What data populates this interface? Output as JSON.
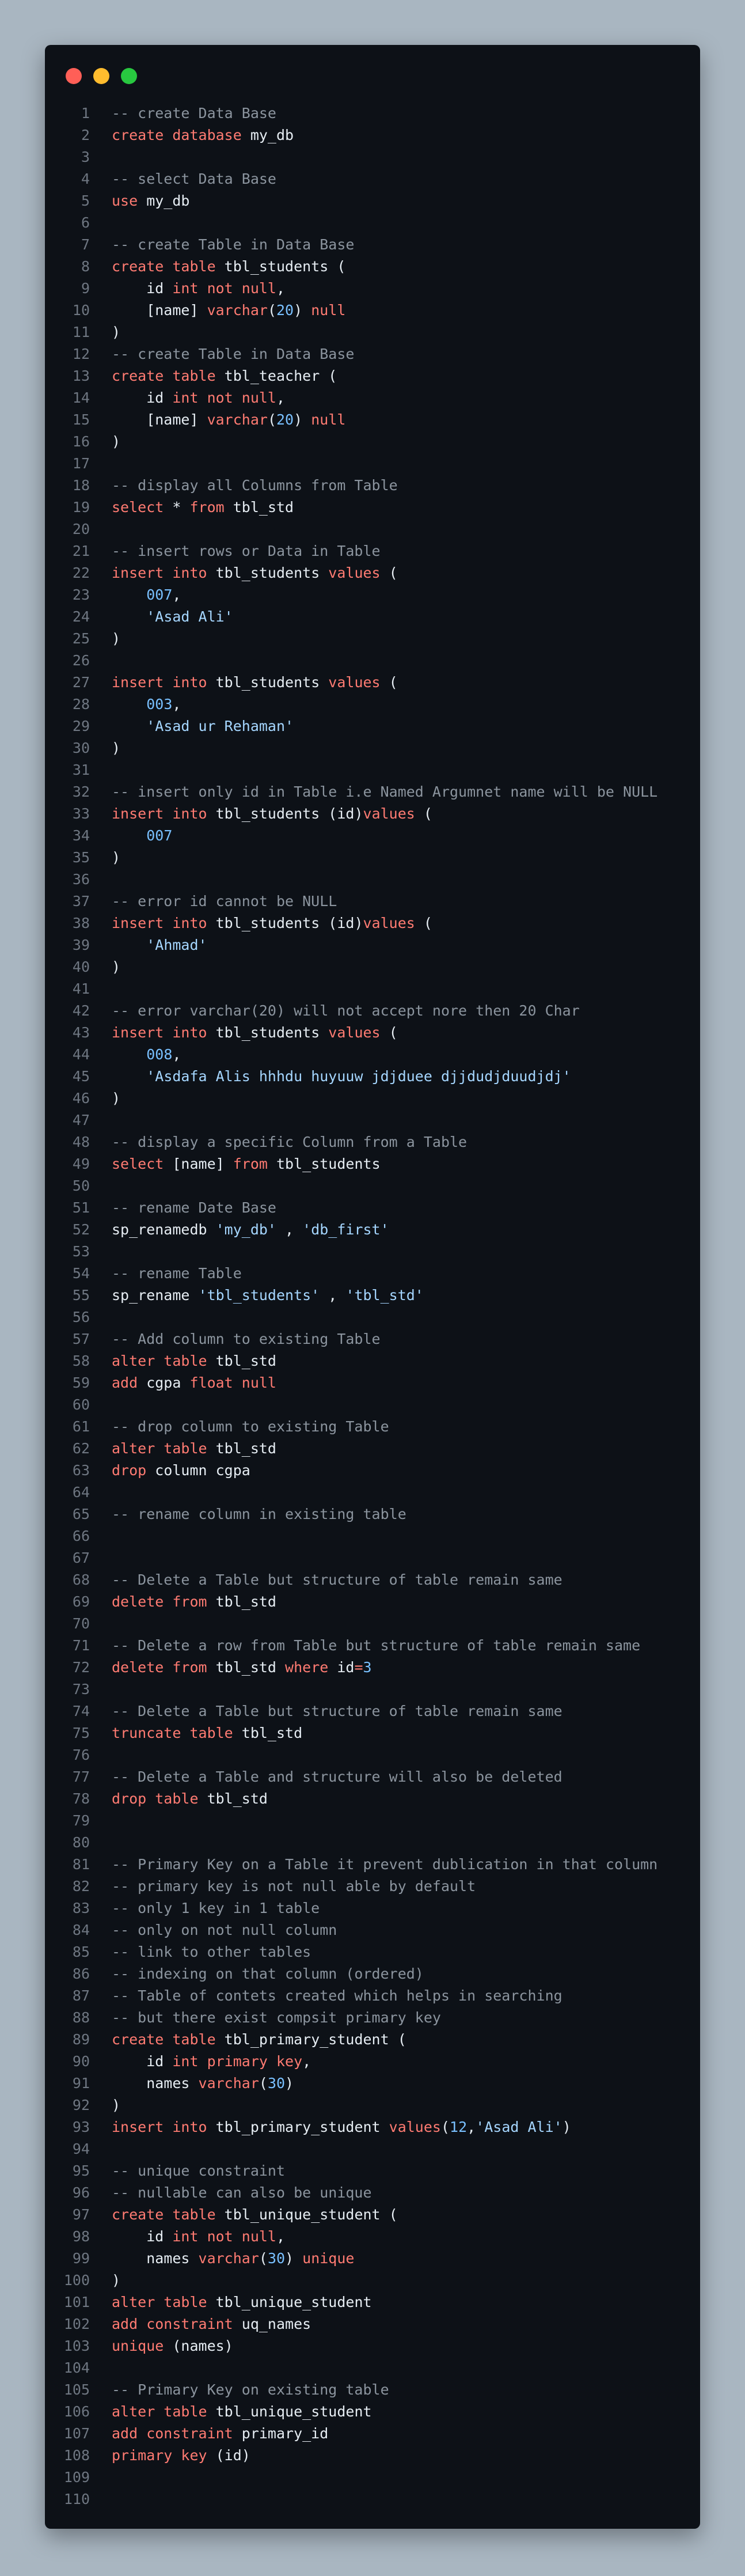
{
  "window": {
    "controls": {
      "close_color": "#ff5f57",
      "minimize_color": "#febc2e",
      "maximize_color": "#28c840"
    }
  },
  "theme": {
    "keyword": "#ff7b72",
    "comment": "#8b949e",
    "string": "#a5d6ff",
    "number": "#79c0ff",
    "text": "#e6edf3",
    "line_number": "#6e7681",
    "background": "#0d1117"
  },
  "editor": {
    "lines": [
      [
        [
          "c",
          "-- create Data Base"
        ]
      ],
      [
        [
          "k",
          "create database"
        ],
        [
          "p",
          " my_db"
        ]
      ],
      [],
      [
        [
          "c",
          "-- select Data Base"
        ]
      ],
      [
        [
          "k",
          "use"
        ],
        [
          "p",
          " my_db"
        ]
      ],
      [],
      [
        [
          "c",
          "-- create Table in Data Base"
        ]
      ],
      [
        [
          "k",
          "create table"
        ],
        [
          "p",
          " tbl_students ("
        ]
      ],
      [
        [
          "p",
          "    id "
        ],
        [
          "k",
          "int not null"
        ],
        [
          "p",
          ","
        ]
      ],
      [
        [
          "p",
          "    [name] "
        ],
        [
          "k",
          "varchar"
        ],
        [
          "p",
          "("
        ],
        [
          "n",
          "20"
        ],
        [
          "p",
          ") "
        ],
        [
          "k",
          "null"
        ]
      ],
      [
        [
          "p",
          ")"
        ]
      ],
      [
        [
          "c",
          "-- create Table in Data Base"
        ]
      ],
      [
        [
          "k",
          "create table"
        ],
        [
          "p",
          " tbl_teacher ("
        ]
      ],
      [
        [
          "p",
          "    id "
        ],
        [
          "k",
          "int not null"
        ],
        [
          "p",
          ","
        ]
      ],
      [
        [
          "p",
          "    [name] "
        ],
        [
          "k",
          "varchar"
        ],
        [
          "p",
          "("
        ],
        [
          "n",
          "20"
        ],
        [
          "p",
          ") "
        ],
        [
          "k",
          "null"
        ]
      ],
      [
        [
          "p",
          ")"
        ]
      ],
      [],
      [
        [
          "c",
          "-- display all Columns from Table"
        ]
      ],
      [
        [
          "k",
          "select"
        ],
        [
          "p",
          " * "
        ],
        [
          "k",
          "from"
        ],
        [
          "p",
          " tbl_std"
        ]
      ],
      [],
      [
        [
          "c",
          "-- insert rows or Data in Table"
        ]
      ],
      [
        [
          "k",
          "insert into"
        ],
        [
          "p",
          " tbl_students "
        ],
        [
          "k",
          "values"
        ],
        [
          "p",
          " ("
        ]
      ],
      [
        [
          "p",
          "    "
        ],
        [
          "n",
          "007"
        ],
        [
          "p",
          ","
        ]
      ],
      [
        [
          "p",
          "    "
        ],
        [
          "s",
          "'Asad Ali'"
        ]
      ],
      [
        [
          "p",
          ")"
        ]
      ],
      [],
      [
        [
          "k",
          "insert into"
        ],
        [
          "p",
          " tbl_students "
        ],
        [
          "k",
          "values"
        ],
        [
          "p",
          " ("
        ]
      ],
      [
        [
          "p",
          "    "
        ],
        [
          "n",
          "003"
        ],
        [
          "p",
          ","
        ]
      ],
      [
        [
          "p",
          "    "
        ],
        [
          "s",
          "'Asad ur Rehaman'"
        ]
      ],
      [
        [
          "p",
          ")"
        ]
      ],
      [],
      [
        [
          "c",
          "-- insert only id in Table i.e Named Argumnet name will be NULL"
        ]
      ],
      [
        [
          "k",
          "insert into"
        ],
        [
          "p",
          " tbl_students (id)"
        ],
        [
          "k",
          "values"
        ],
        [
          "p",
          " ("
        ]
      ],
      [
        [
          "p",
          "    "
        ],
        [
          "n",
          "007"
        ]
      ],
      [
        [
          "p",
          ")"
        ]
      ],
      [],
      [
        [
          "c",
          "-- error id cannot be NULL"
        ]
      ],
      [
        [
          "k",
          "insert into"
        ],
        [
          "p",
          " tbl_students (id)"
        ],
        [
          "k",
          "values"
        ],
        [
          "p",
          " ("
        ]
      ],
      [
        [
          "p",
          "    "
        ],
        [
          "s",
          "'Ahmad'"
        ]
      ],
      [
        [
          "p",
          ")"
        ]
      ],
      [],
      [
        [
          "c",
          "-- error varchar(20) will not accept nore then 20 Char"
        ]
      ],
      [
        [
          "k",
          "insert into"
        ],
        [
          "p",
          " tbl_students "
        ],
        [
          "k",
          "values"
        ],
        [
          "p",
          " ("
        ]
      ],
      [
        [
          "p",
          "    "
        ],
        [
          "n",
          "008"
        ],
        [
          "p",
          ","
        ]
      ],
      [
        [
          "p",
          "    "
        ],
        [
          "s",
          "'Asdafa Alis hhhdu huyuuw jdjduee djjdudjduudjdj'"
        ]
      ],
      [
        [
          "p",
          ")"
        ]
      ],
      [],
      [
        [
          "c",
          "-- display a specific Column from a Table"
        ]
      ],
      [
        [
          "k",
          "select"
        ],
        [
          "p",
          " [name] "
        ],
        [
          "k",
          "from"
        ],
        [
          "p",
          " tbl_students"
        ]
      ],
      [],
      [
        [
          "c",
          "-- rename Date Base"
        ]
      ],
      [
        [
          "p",
          "sp_renamedb "
        ],
        [
          "s",
          "'my_db'"
        ],
        [
          "p",
          " , "
        ],
        [
          "s",
          "'db_first'"
        ]
      ],
      [],
      [
        [
          "c",
          "-- rename Table"
        ]
      ],
      [
        [
          "p",
          "sp_rename "
        ],
        [
          "s",
          "'tbl_students'"
        ],
        [
          "p",
          " , "
        ],
        [
          "s",
          "'tbl_std'"
        ]
      ],
      [],
      [
        [
          "c",
          "-- Add column to existing Table"
        ]
      ],
      [
        [
          "k",
          "alter table"
        ],
        [
          "p",
          " tbl_std"
        ]
      ],
      [
        [
          "k",
          "add"
        ],
        [
          "p",
          " cgpa "
        ],
        [
          "k",
          "float null"
        ]
      ],
      [],
      [
        [
          "c",
          "-- drop column to existing Table"
        ]
      ],
      [
        [
          "k",
          "alter table"
        ],
        [
          "p",
          " tbl_std"
        ]
      ],
      [
        [
          "k",
          "drop"
        ],
        [
          "p",
          " column cgpa"
        ]
      ],
      [],
      [
        [
          "c",
          "-- rename column in existing table"
        ]
      ],
      [],
      [],
      [
        [
          "c",
          "-- Delete a Table but structure of table remain same"
        ]
      ],
      [
        [
          "k",
          "delete from"
        ],
        [
          "p",
          " tbl_std"
        ]
      ],
      [],
      [
        [
          "c",
          "-- Delete a row from Table but structure of table remain same"
        ]
      ],
      [
        [
          "k",
          "delete from"
        ],
        [
          "p",
          " tbl_std "
        ],
        [
          "k",
          "where"
        ],
        [
          "p",
          " id"
        ],
        [
          "k",
          "="
        ],
        [
          "n",
          "3"
        ]
      ],
      [],
      [
        [
          "c",
          "-- Delete a Table but structure of table remain same"
        ]
      ],
      [
        [
          "k",
          "truncate table"
        ],
        [
          "p",
          " tbl_std"
        ]
      ],
      [],
      [
        [
          "c",
          "-- Delete a Table and structure will also be deleted"
        ]
      ],
      [
        [
          "k",
          "drop table"
        ],
        [
          "p",
          " tbl_std"
        ]
      ],
      [],
      [],
      [
        [
          "c",
          "-- Primary Key on a Table it prevent dublication in that column"
        ]
      ],
      [
        [
          "c",
          "-- primary key is not null able by default"
        ]
      ],
      [
        [
          "c",
          "-- only 1 key in 1 table"
        ]
      ],
      [
        [
          "c",
          "-- only on not null column"
        ]
      ],
      [
        [
          "c",
          "-- link to other tables"
        ]
      ],
      [
        [
          "c",
          "-- indexing on that column (ordered)"
        ]
      ],
      [
        [
          "c",
          "-- Table of contets created which helps in searching"
        ]
      ],
      [
        [
          "c",
          "-- but there exist compsit primary key"
        ]
      ],
      [
        [
          "k",
          "create table"
        ],
        [
          "p",
          " tbl_primary_student ("
        ]
      ],
      [
        [
          "p",
          "    id "
        ],
        [
          "k",
          "int primary key"
        ],
        [
          "p",
          ","
        ]
      ],
      [
        [
          "p",
          "    names "
        ],
        [
          "k",
          "varchar"
        ],
        [
          "p",
          "("
        ],
        [
          "n",
          "30"
        ],
        [
          "p",
          ")"
        ]
      ],
      [
        [
          "p",
          ")"
        ]
      ],
      [
        [
          "k",
          "insert into"
        ],
        [
          "p",
          " tbl_primary_student "
        ],
        [
          "k",
          "values"
        ],
        [
          "p",
          "("
        ],
        [
          "n",
          "12"
        ],
        [
          "p",
          ","
        ],
        [
          "s",
          "'Asad Ali'"
        ],
        [
          "p",
          ")"
        ]
      ],
      [],
      [
        [
          "c",
          "-- unique constraint"
        ]
      ],
      [
        [
          "c",
          "-- nullable can also be unique"
        ]
      ],
      [
        [
          "k",
          "create table"
        ],
        [
          "p",
          " tbl_unique_student ("
        ]
      ],
      [
        [
          "p",
          "    id "
        ],
        [
          "k",
          "int not null"
        ],
        [
          "p",
          ","
        ]
      ],
      [
        [
          "p",
          "    names "
        ],
        [
          "k",
          "varchar"
        ],
        [
          "p",
          "("
        ],
        [
          "n",
          "30"
        ],
        [
          "p",
          ") "
        ],
        [
          "k",
          "unique"
        ]
      ],
      [
        [
          "p",
          ")"
        ]
      ],
      [
        [
          "k",
          "alter table"
        ],
        [
          "p",
          " tbl_unique_student"
        ]
      ],
      [
        [
          "k",
          "add constraint"
        ],
        [
          "p",
          " uq_names"
        ]
      ],
      [
        [
          "k",
          "unique"
        ],
        [
          "p",
          " (names)"
        ]
      ],
      [],
      [
        [
          "c",
          "-- Primary Key on existing table"
        ]
      ],
      [
        [
          "k",
          "alter table"
        ],
        [
          "p",
          " tbl_unique_student"
        ]
      ],
      [
        [
          "k",
          "add constraint"
        ],
        [
          "p",
          " primary_id"
        ]
      ],
      [
        [
          "k",
          "primary key"
        ],
        [
          "p",
          " (id)"
        ]
      ],
      [],
      []
    ]
  }
}
